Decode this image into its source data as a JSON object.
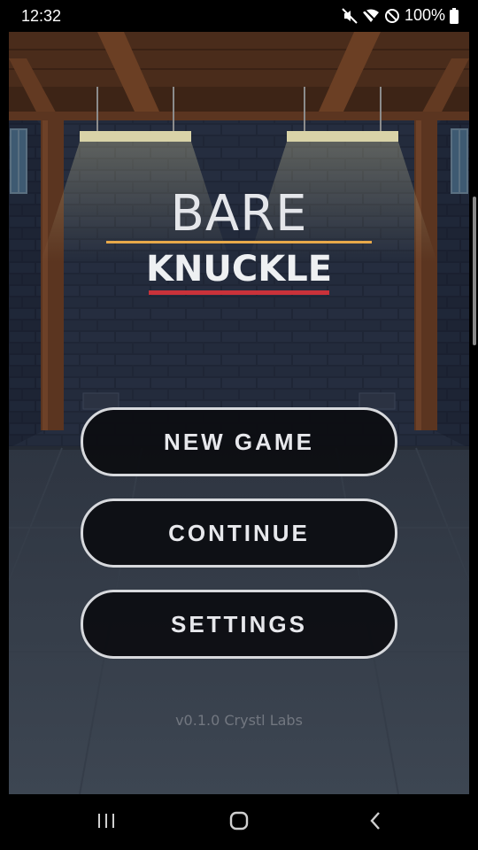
{
  "status_bar": {
    "time": "12:32",
    "battery_percent": "100%",
    "icons": [
      "mute-icon",
      "wifi-icon",
      "dnd-icon",
      "battery-icon"
    ]
  },
  "title": {
    "line1": "BARE",
    "line2": "KNUCKLE"
  },
  "menu": {
    "new_game": "NEW GAME",
    "continue": "CONTINUE",
    "settings": "SETTINGS"
  },
  "footer": {
    "version": "v0.1.0 Crystl Labs"
  },
  "nav_bar": {
    "icons": [
      "recent-apps-icon",
      "home-icon",
      "back-icon"
    ]
  },
  "colors": {
    "title_underline_1": "#e8a94a",
    "title_underline_2": "#c9323a",
    "wall": "#1f2635",
    "beam": "#5a341f",
    "floor": "#3a4350",
    "button_border": "#d7d9dd",
    "button_fill": "#0c0d11"
  }
}
